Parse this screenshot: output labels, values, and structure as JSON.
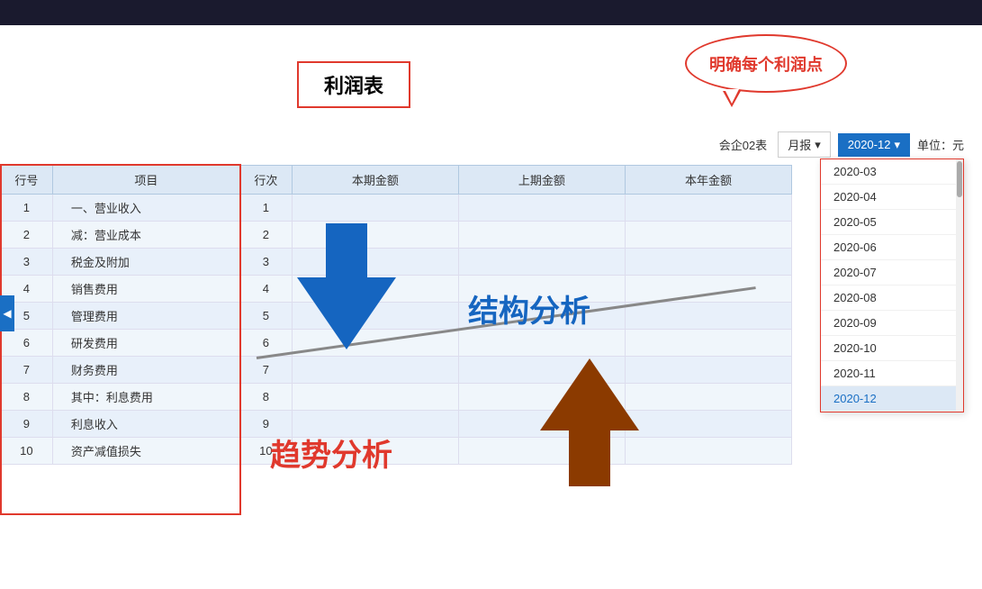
{
  "topBar": {
    "background": "#1a1a2e"
  },
  "callout": {
    "text": "明确每个利润点"
  },
  "title": {
    "text": "利润表"
  },
  "controls": {
    "companyLabel": "会企02表",
    "periodType": "月报",
    "selectedPeriod": "2020-12",
    "unitLabel": "单位：元"
  },
  "table": {
    "headers": [
      "行号",
      "项目",
      "行次",
      "本期金额",
      "上期金额",
      "本年金额"
    ],
    "rows": [
      {
        "id": 1,
        "name": "一、营业收入",
        "seq": 1,
        "current": "",
        "prior": "",
        "yearly": ""
      },
      {
        "id": 2,
        "name": "减：营业成本",
        "seq": 2,
        "current": "",
        "prior": "",
        "yearly": ""
      },
      {
        "id": 3,
        "name": "税金及附加",
        "seq": 3,
        "current": "",
        "prior": "",
        "yearly": ""
      },
      {
        "id": 4,
        "name": "销售费用",
        "seq": 4,
        "current": "",
        "prior": "",
        "yearly": ""
      },
      {
        "id": 5,
        "name": "管理费用",
        "seq": 5,
        "current": "",
        "prior": "",
        "yearly": ""
      },
      {
        "id": 6,
        "name": "研发费用",
        "seq": 6,
        "current": "",
        "prior": "",
        "yearly": ""
      },
      {
        "id": 7,
        "name": "财务费用",
        "seq": 7,
        "current": "",
        "prior": "",
        "yearly": ""
      },
      {
        "id": 8,
        "name": "其中：利息费用",
        "seq": 8,
        "current": "",
        "prior": "",
        "yearly": ""
      },
      {
        "id": 9,
        "name": "利息收入",
        "seq": 9,
        "current": "",
        "prior": "",
        "yearly": ""
      },
      {
        "id": 10,
        "name": "资产减值损失",
        "seq": 10,
        "current": "",
        "prior": "",
        "yearly": ""
      }
    ]
  },
  "dropdown": {
    "items": [
      "2020-03",
      "2020-04",
      "2020-05",
      "2020-06",
      "2020-07",
      "2020-08",
      "2020-09",
      "2020-10",
      "2020-11",
      "2020-12"
    ],
    "selected": "2020-12"
  },
  "annotations": {
    "structureAnalysis": "结构分析",
    "trendAnalysis": "趋势分析"
  }
}
